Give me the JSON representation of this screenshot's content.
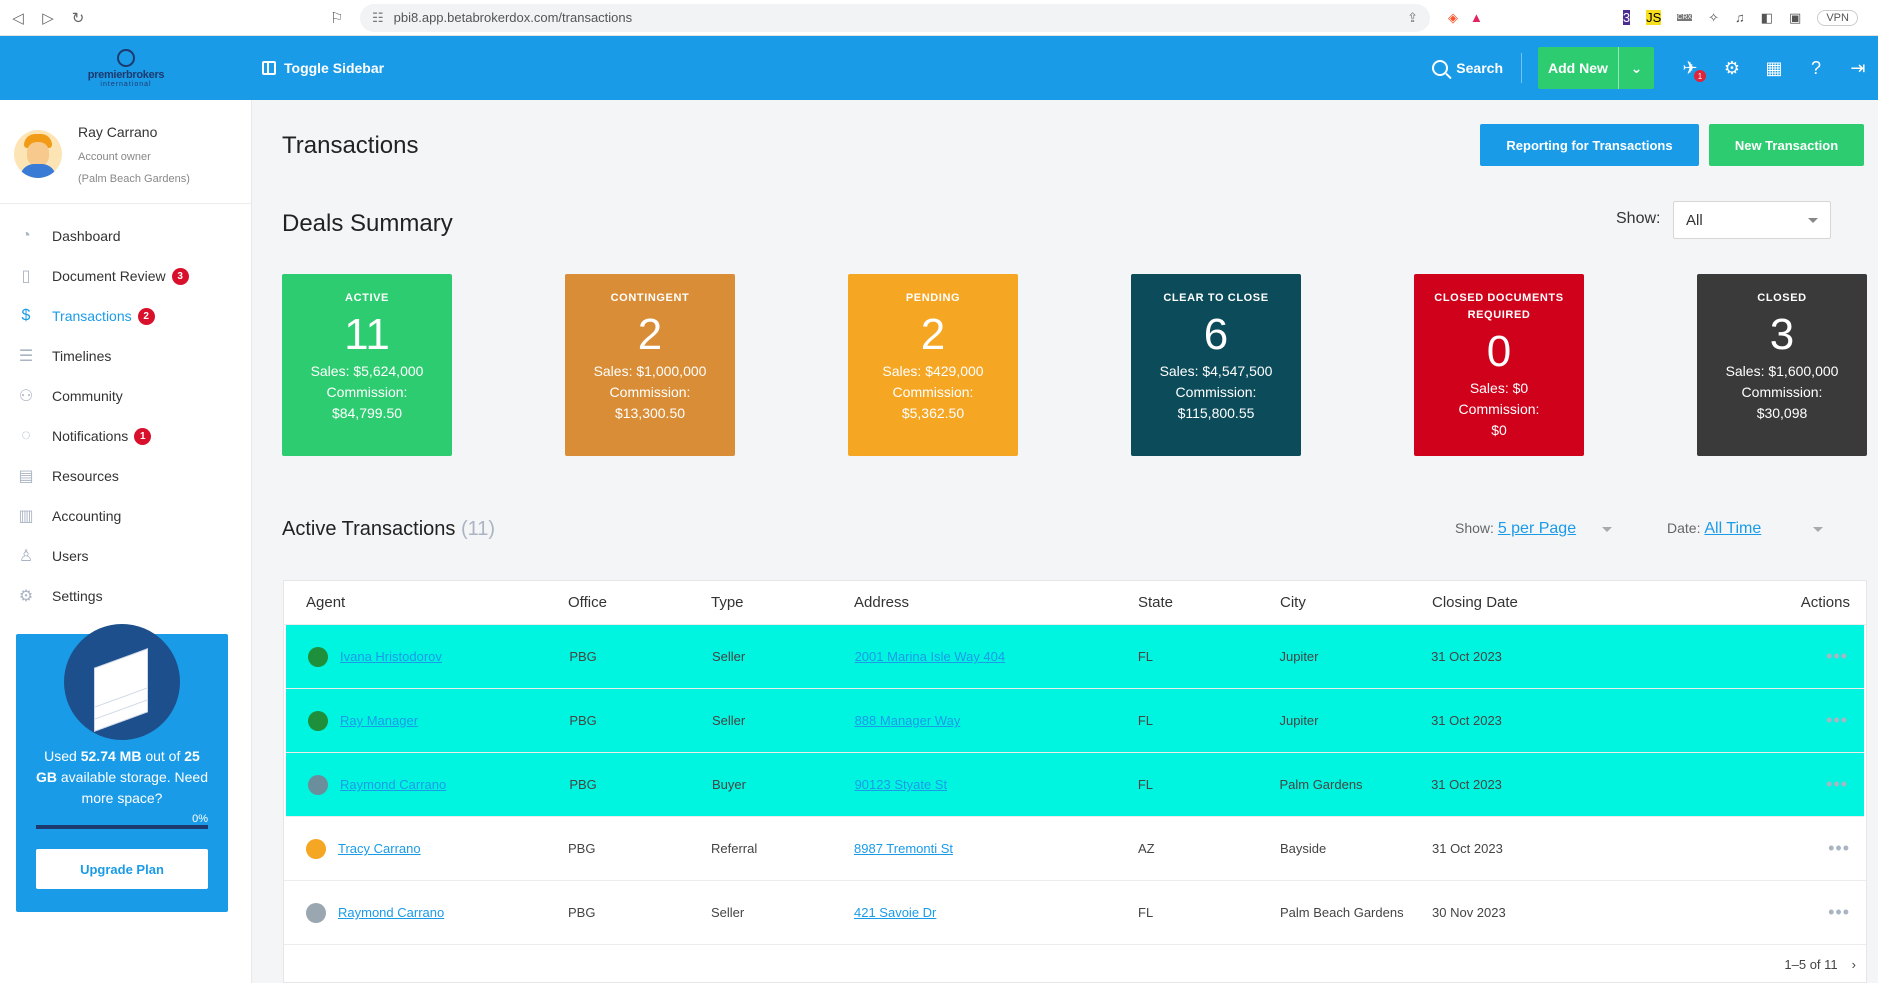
{
  "browser": {
    "url": "pbi8.app.betabrokerdox.com/transactions",
    "ext_js": "JS",
    "ext_crx": "CRX",
    "ext_badge": "3",
    "vpn": "VPN"
  },
  "header": {
    "logo_word": "premierbrokers",
    "logo_sub": "international",
    "toggle_sidebar": "Toggle Sidebar",
    "search": "Search",
    "add_new": "Add New",
    "notif_badge": "1"
  },
  "profile": {
    "name": "Ray Carrano",
    "role": "Account owner",
    "office": "(Palm Beach Gardens)"
  },
  "menu": [
    {
      "label": "Dashboard",
      "icon": "speedometer-icon",
      "count": ""
    },
    {
      "label": "Document Review",
      "icon": "document-icon",
      "count": "3"
    },
    {
      "label": "Transactions",
      "icon": "dollar-cycle-icon",
      "count": "2"
    },
    {
      "label": "Timelines",
      "icon": "timeline-icon",
      "count": ""
    },
    {
      "label": "Community",
      "icon": "community-icon",
      "count": ""
    },
    {
      "label": "Notifications",
      "icon": "chat-icon",
      "count": "1"
    },
    {
      "label": "Resources",
      "icon": "folder-icon",
      "count": ""
    },
    {
      "label": "Accounting",
      "icon": "accounting-icon",
      "count": ""
    },
    {
      "label": "Users",
      "icon": "user-icon",
      "count": ""
    },
    {
      "label": "Settings",
      "icon": "gear-icon",
      "count": ""
    }
  ],
  "storage": {
    "used_prefix": "Used ",
    "used": "52.74 MB",
    "mid": " out of ",
    "total": "25 GB",
    "suffix": " available storage. Need more space?",
    "percent": "0%",
    "upgrade": "Upgrade Plan"
  },
  "page": {
    "title": "Transactions",
    "report_btn": "Reporting for Transactions",
    "new_btn": "New Transaction",
    "deals_title": "Deals Summary",
    "show_label": "Show:",
    "show_value": "All"
  },
  "cards": [
    {
      "title": "ACTIVE",
      "value": "11",
      "sales": "Sales: $5,624,000",
      "commission_label": "Commission:",
      "commission": "$84,799.50",
      "color": "#2ecc71"
    },
    {
      "title": "CONTINGENT",
      "value": "2",
      "sales": "Sales: $1,000,000",
      "commission_label": "Commission:",
      "commission": "$13,300.50",
      "color": "#d98d36"
    },
    {
      "title": "PENDING",
      "value": "2",
      "sales": "Sales: $429,000",
      "commission_label": "Commission:",
      "commission": "$5,362.50",
      "color": "#f5a623"
    },
    {
      "title": "CLEAR TO CLOSE",
      "value": "6",
      "sales": "Sales: $4,547,500",
      "commission_label": "Commission:",
      "commission": "$115,800.55",
      "color": "#0c4b5a"
    },
    {
      "title": "CLOSED DOCUMENTS REQUIRED",
      "value": "0",
      "sales": "Sales: $0",
      "commission_label": "Commission:",
      "commission": "$0",
      "color": "#d0021b"
    },
    {
      "title": "CLOSED",
      "value": "3",
      "sales": "Sales: $1,600,000",
      "commission_label": "Commission:",
      "commission": "$30,098",
      "color": "#3a3a3a"
    }
  ],
  "active": {
    "title": "Active Transactions",
    "count": "(11)",
    "show_label": "Show:",
    "per_page": "5 per Page",
    "date_label": "Date:",
    "date_value": "All Time"
  },
  "table": {
    "headers": [
      "Agent",
      "Office",
      "Type",
      "Address",
      "State",
      "City",
      "Closing Date",
      "Actions"
    ],
    "rows": [
      {
        "agent": "Ivana Hristodorov",
        "office": "PBG",
        "type": "Seller",
        "address": "2001 Marina Isle Way 404",
        "state": "FL",
        "city": "Jupiter",
        "date": "31 Oct 2023",
        "highlight": true,
        "avatar": "#1e8f3a"
      },
      {
        "agent": "Ray Manager",
        "office": "PBG",
        "type": "Seller",
        "address": "888 Manager Way",
        "state": "FL",
        "city": "Jupiter",
        "date": "31 Oct 2023",
        "highlight": true,
        "avatar": "#1e8f3a"
      },
      {
        "agent": "Raymond Carrano",
        "office": "PBG",
        "type": "Buyer",
        "address": "90123 Styate St",
        "state": "FL",
        "city": "Palm Gardens",
        "date": "31 Oct 2023",
        "highlight": true,
        "avatar": "#6b8e9c"
      },
      {
        "agent": "Tracy Carrano",
        "office": "PBG",
        "type": "Referral",
        "address": "8987 Tremonti St",
        "state": "AZ",
        "city": "Bayside",
        "date": "31 Oct 2023",
        "highlight": false,
        "avatar": "#f5a623"
      },
      {
        "agent": "Raymond Carrano",
        "office": "PBG",
        "type": "Seller",
        "address": "421 Savoie Dr",
        "state": "FL",
        "city": "Palm Beach Gardens",
        "date": "30 Nov 2023",
        "highlight": false,
        "avatar": "#9aa7b0"
      }
    ],
    "pager": "1–5 of 11"
  }
}
